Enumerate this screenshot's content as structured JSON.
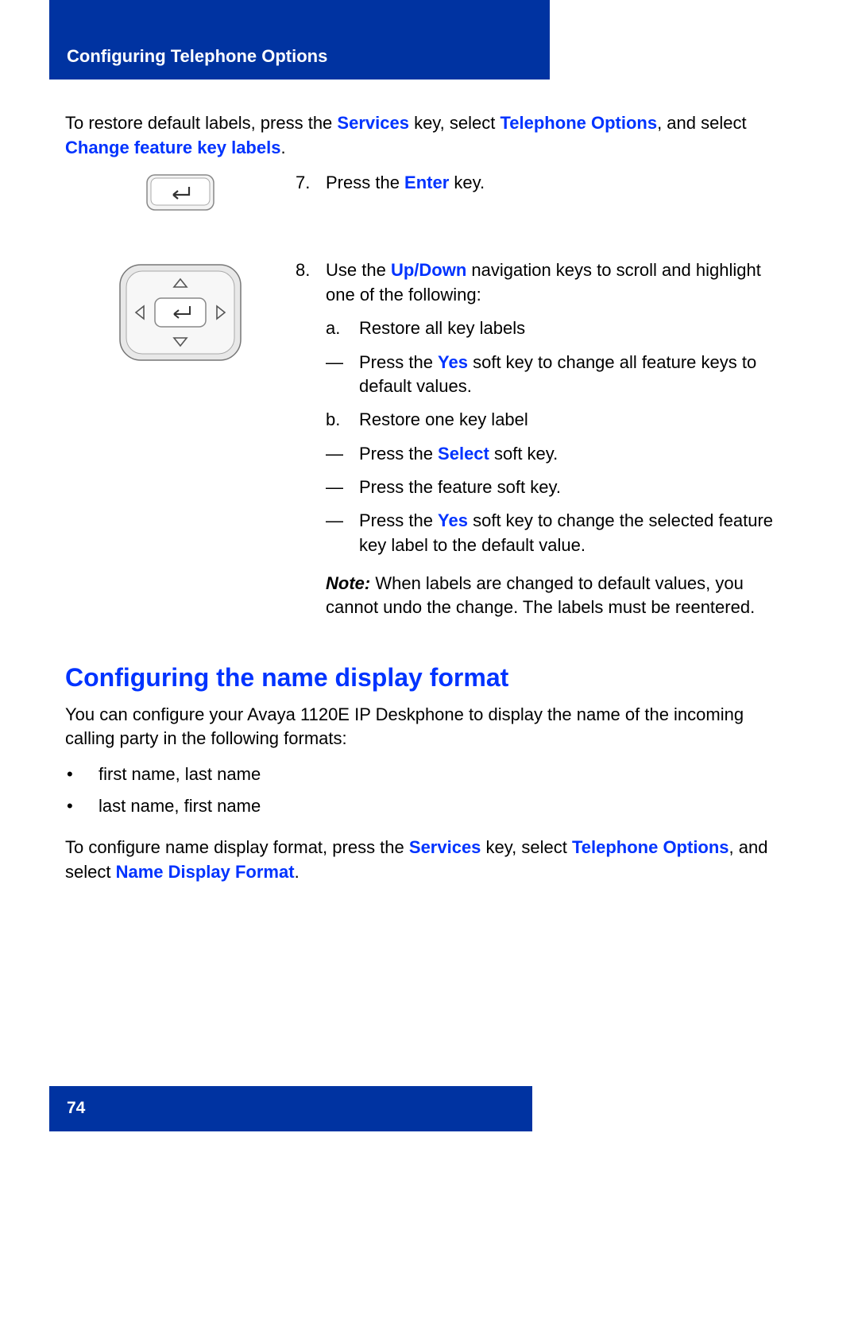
{
  "header": {
    "title": "Configuring Telephone Options"
  },
  "intro": {
    "p1_a": "To restore default labels, press the ",
    "p1_b": "Services",
    "p1_c": " key, select ",
    "p1_d": "Telephone Options",
    "p1_e": ", and select ",
    "p1_f": "Change feature key labels",
    "p1_g": "."
  },
  "step7": {
    "num": "7.",
    "a": "Press the ",
    "b": "Enter",
    "c": " key."
  },
  "step8": {
    "num": "8.",
    "a": "Use the ",
    "b": "Up/Down",
    "c": " navigation keys to scroll and highlight one of the following:",
    "sub_a_mark": "a.",
    "sub_a_text": "Restore all key labels",
    "dash": "—",
    "d1_a": "Press the ",
    "d1_b": "Yes",
    "d1_c": " soft key to change all feature keys to default values.",
    "sub_b_mark": "b.",
    "sub_b_text": "Restore one key label",
    "d2_a": "Press the ",
    "d2_b": "Select",
    "d2_c": " soft key.",
    "d3": "Press the feature soft key.",
    "d4_a": "Press the ",
    "d4_b": "Yes",
    "d4_c": " soft key to change the selected feature key label to the default value.",
    "note_label": "Note:",
    "note_text": " When labels are changed to default values, you cannot undo the change. The labels must be reentered."
  },
  "section2": {
    "title": "Configuring the name display format",
    "p1": "You can configure your Avaya 1120E IP Deskphone to display the name of the incoming calling party in the following formats:",
    "bullet_mark": "•",
    "b1": "first name, last name",
    "b2": "last name, first name",
    "p2_a": "To configure name display format, press the ",
    "p2_b": "Services",
    "p2_c": " key, select ",
    "p2_d": "Telephone Options",
    "p2_e": ", and select ",
    "p2_f": "Name Display Format",
    "p2_g": "."
  },
  "footer": {
    "page_number": "74"
  }
}
